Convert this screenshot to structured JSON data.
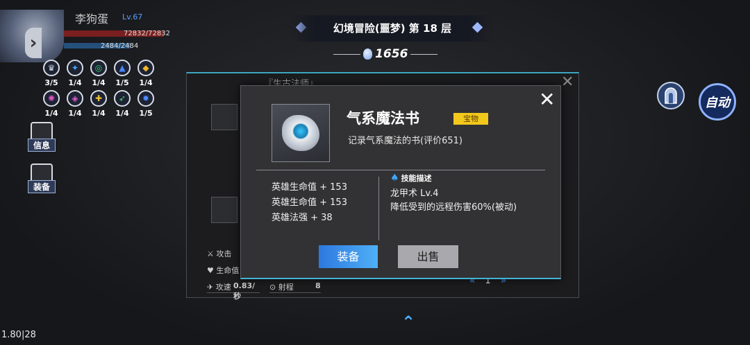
{
  "player": {
    "name": "李狗蛋",
    "level": "Lv.67",
    "hp_text": "72832/72832",
    "mp_text": "2484/2484"
  },
  "buffs": [
    {
      "icon": "shield-buff-icon",
      "glyph": "♛",
      "color": "#cfd6e6",
      "count": "3/5"
    },
    {
      "icon": "blue-rune-icon",
      "glyph": "✦",
      "color": "#49a3ff",
      "count": "1/4"
    },
    {
      "icon": "green-ring-icon",
      "glyph": "◎",
      "color": "#38d06a",
      "count": "1/4"
    },
    {
      "icon": "mage-hat-icon",
      "glyph": "▲",
      "color": "#4a86ff",
      "count": "1/5"
    },
    {
      "icon": "gold-helmet-icon",
      "glyph": "◆",
      "color": "#f0b52a",
      "count": "1/4"
    },
    {
      "icon": "pink-orb-icon",
      "glyph": "✺",
      "color": "#e057c8",
      "count": "1/4"
    },
    {
      "icon": "pink-gem-icon",
      "glyph": "◈",
      "color": "#e35ad6",
      "count": "1/4"
    },
    {
      "icon": "gold-cross-icon",
      "glyph": "✚",
      "color": "#e9c03a",
      "count": "1/4"
    },
    {
      "icon": "green-runner-icon",
      "glyph": "➶",
      "color": "#4cd37a",
      "count": "1/4"
    },
    {
      "icon": "blue-gear-icon",
      "glyph": "✹",
      "color": "#4f8dff",
      "count": "1/5"
    }
  ],
  "side_buttons": {
    "info": "信息",
    "equip": "装备"
  },
  "banner": {
    "title": "幻境冒险(噩梦) 第 18 层",
    "gems": "1656"
  },
  "auto_button": "自动",
  "back_panel": {
    "title": "『生古法师』",
    "stats": [
      {
        "label": "攻击",
        "icon": "sword-icon",
        "value": ""
      },
      {
        "label": "生命值",
        "icon": "heart-icon",
        "value": ""
      },
      {
        "label": "攻速",
        "icon": "speed-icon",
        "value": "0.83/秒"
      },
      {
        "label": "射程",
        "icon": "range-icon",
        "value": "8"
      }
    ],
    "page": "1"
  },
  "item": {
    "name": "气系魔法书",
    "tag": "宝物",
    "description": "记录气系魔法的书(评价651)",
    "stats": [
      "英雄生命值 + 153",
      "英雄生命值 + 153",
      "英雄法强 + 38"
    ],
    "skill_header": "技能描述",
    "skill_name": "龙甲术 Lv.4",
    "skill_desc": "降低受到的远程伤害60%(被动)"
  },
  "buttons": {
    "equip": "装备",
    "sell": "出售"
  },
  "version": "1.80|28",
  "colors": {
    "accent": "#45b4d6",
    "equip_button": "#3a8fe8",
    "tag": "#f2c81c"
  }
}
